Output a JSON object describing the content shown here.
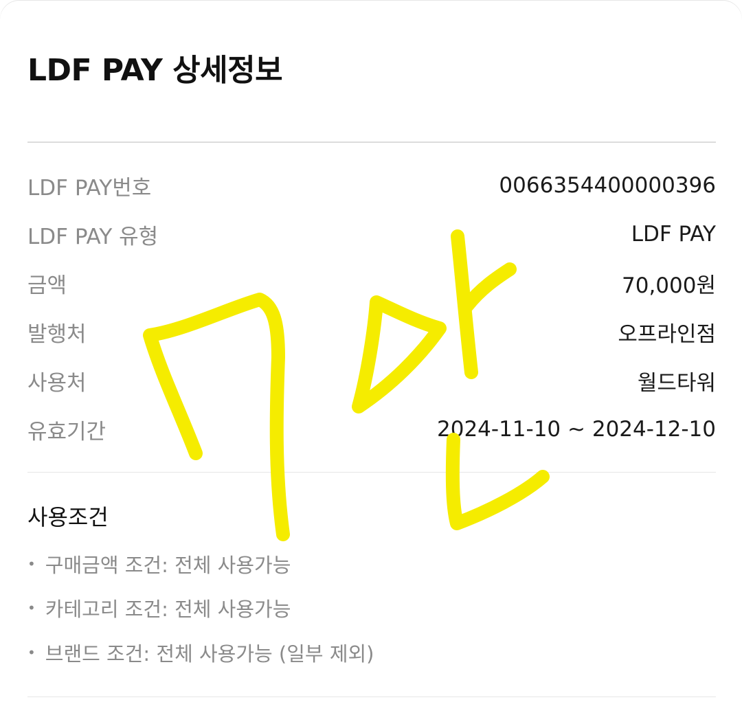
{
  "title": "LDF PAY 상세정보",
  "details": [
    {
      "label": "LDF PAY번호",
      "value": "0066354400000396"
    },
    {
      "label": "LDF PAY 유형",
      "value": "LDF PAY"
    },
    {
      "label": "금액",
      "value": "70,000원"
    },
    {
      "label": "발행처",
      "value": "오프라인점"
    },
    {
      "label": "사용처",
      "value": "월드타워"
    },
    {
      "label": "유효기간",
      "value": "2024-11-10 ~ 2024-12-10"
    }
  ],
  "conditions": {
    "title": "사용조건",
    "bullet": "•",
    "items": [
      "구매금액 조건: 전체 사용가능",
      "카테고리 조건: 전체 사용가능",
      "브랜드 조건: 전체 사용가능 (일부 제외)"
    ]
  },
  "handwriting": {
    "text": "7만",
    "color": "#f5ec00"
  }
}
